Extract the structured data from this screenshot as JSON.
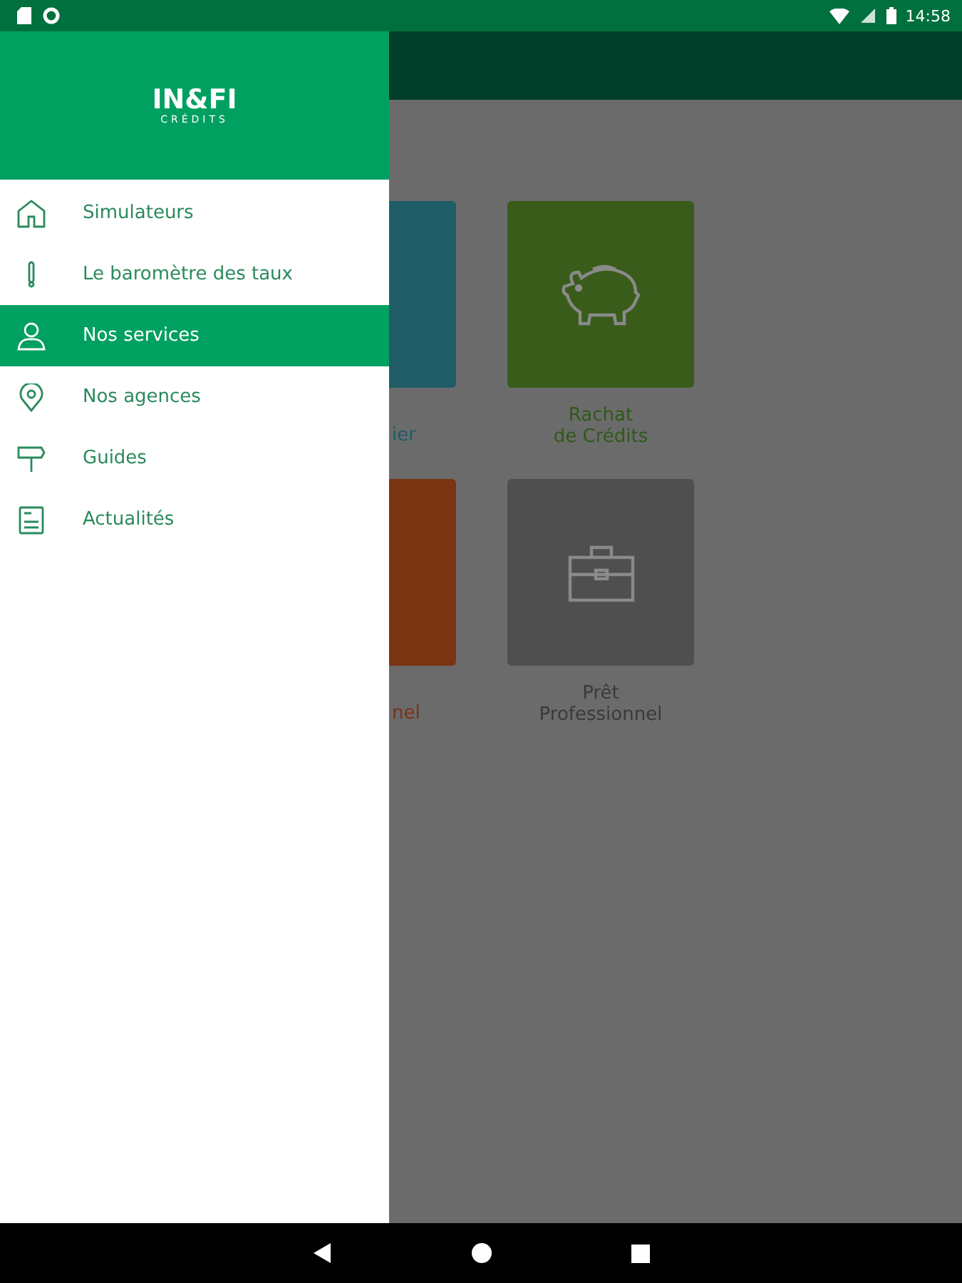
{
  "status_bar": {
    "time": "14:58"
  },
  "drawer": {
    "logo": {
      "title": "IN&FI",
      "subtitle": "CRÉDITS"
    },
    "items": [
      {
        "label": "Simulateurs",
        "selected": false
      },
      {
        "label": "Le baromètre des taux",
        "selected": false
      },
      {
        "label": "Nos services",
        "selected": true
      },
      {
        "label": "Nos agences",
        "selected": false
      },
      {
        "label": "Guides",
        "selected": false
      },
      {
        "label": "Actualités",
        "selected": false
      }
    ]
  },
  "tiles": [
    {
      "kind": "partial",
      "label": [
        "ier"
      ],
      "color": "#1f5c68"
    },
    {
      "kind": "full",
      "label": [
        "Rachat",
        "de Crédits"
      ],
      "color": "#3a5c1a"
    },
    {
      "kind": "partial",
      "label": [
        "nel"
      ],
      "color": "#7a3412"
    },
    {
      "kind": "full",
      "label": [
        "Prêt",
        "Professionnel"
      ],
      "color": "#4f4f4f"
    }
  ]
}
